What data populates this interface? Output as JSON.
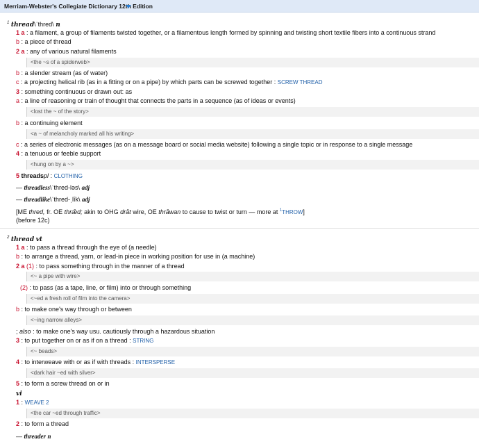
{
  "header": {
    "title": "Merriam-Webster's Collegiate Dictionary 12th Edition"
  },
  "e1": {
    "hom": "1",
    "hw": "thread",
    "pron": "\\ˈthred\\",
    "pos": "n",
    "s1a_num": "1 a",
    "s1a": ": a filament, a group of filaments twisted together, or a filamentous length formed by spinning and twisting short textile fibers into a continuous strand",
    "s1b_lbl": "b",
    "s1b": ": a piece of thread",
    "s2a_num": "2 a",
    "s2a": ": any of various natural filaments",
    "ex1": "<the ~s of a spiderweb>",
    "s2b_lbl": "b",
    "s2b": ": a slender stream (as of water)",
    "s2c_lbl": "c",
    "s2c": ": a projecting helical rib (as in a fitting or on a pipe) by which parts can be screwed together :",
    "s2c_x": "SCREW THREAD",
    "s3_num": "3",
    "s3": ": something continuous or drawn out: as",
    "s3a_lbl": "a",
    "s3a": ": a line of reasoning or train of thought that connects the parts in a sequence (as of ideas or events)",
    "ex2": "<lost the ~ of the story>",
    "s3b_lbl": "b",
    "s3b": ": a continuing element",
    "ex3": "<a ~ of melancholy marked all his writing>",
    "s3c_lbl": "c",
    "s3c": ": a series of electronic messages (as on a message board or social media website) following a single topic or in response to a single message",
    "s4_num": "4",
    "s4": ": a tenuous or feeble support",
    "ex4": "<hung on by a ~>",
    "s5_num": "5",
    "s5_w": "threads",
    "s5_pl": "pl",
    "s5_c": " :",
    "s5_x": "CLOTHING",
    "r1_dash": "—",
    "r1_w": "threadless",
    "r1_p": "\\ˈthred-ləs\\",
    "r1_pos": "adj",
    "r2_dash": "—",
    "r2_w": "threadlike",
    "r2_p": "\\ˈthred-ˌlīk\\",
    "r2_pos": "adj",
    "et_a": "[ME",
    "et_b": "thred,",
    "et_c": "fr. OE",
    "et_d": "thrǣd;",
    "et_e": "akin to OHG",
    "et_f": "drāt",
    "et_g": "wire, OE",
    "et_h": "thrāwan",
    "et_i": "to cause to twist or turn — more at",
    "et_sup": "1",
    "et_x": "THROW",
    "et_end": "]",
    "date": "(before 12c)"
  },
  "e2": {
    "hom": "2",
    "hw": "thread",
    "pos": "vt",
    "s1a_num": "1 a",
    "s1a": ": to pass a thread through the eye of (a needle)",
    "s1b_lbl": "b",
    "s1b": ": to arrange a thread, yarn, or lead-in piece in working position for use in (a machine)",
    "s2a_num": "2 a",
    "s2a_sub": "(1)",
    "s2a": ": to pass something through in the manner of a thread",
    "ex1": "<~ a pipe with wire>",
    "s2a2_sub": "(2)",
    "s2a2": ": to pass (as a tape, line, or film) into or through something",
    "ex2": "<~ed a fresh roll of film into the camera>",
    "s2b_lbl": "b",
    "s2b": ": to make one's way through or between",
    "ex3": "<~ing narrow alleys>",
    "also_pre": ";",
    "also_w": "also",
    "also": ": to make one's way usu. cautiously through a hazardous situation",
    "s3_num": "3",
    "s3": ": to put together on or as if on a thread :",
    "s3_x": "STRING",
    "ex4": "<~ beads>",
    "s4_num": "4",
    "s4": ": to interweave with or as if with threads :",
    "s4_x": "INTERSPERSE",
    "ex5": "<dark hair ~ed with silver>",
    "s5_num": "5",
    "s5": ": to form a screw thread on or in",
    "vi": "vi",
    "vi1_num": "1",
    "vi1_c": ":",
    "vi1_x": "WEAVE 2",
    "ex6": "<the car ~ed through traffic>",
    "vi2_num": "2",
    "vi2": ": to form a thread",
    "r_dash": "—",
    "r_w": "threader",
    "r_pos": "n"
  }
}
